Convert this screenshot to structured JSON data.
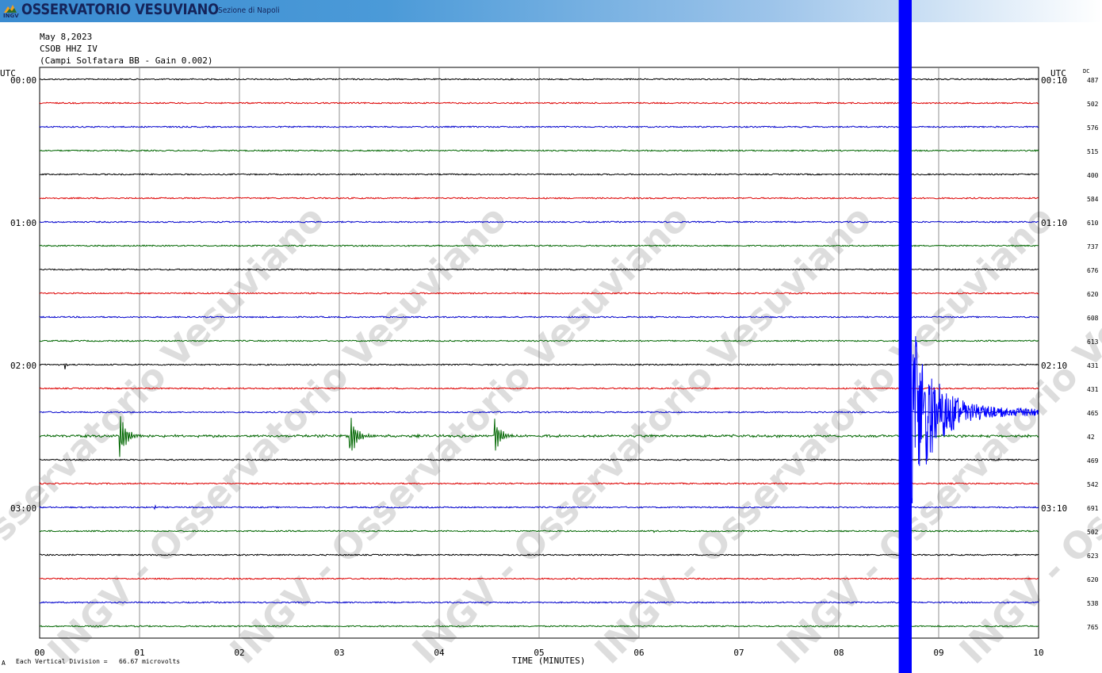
{
  "header": {
    "org_name": "OSSERVATORIO VESUVIANO",
    "org_sub": "Sezione di Napoli",
    "logo_text": "INGV"
  },
  "info": {
    "date": "May 8,2023",
    "station": "CSOB HHZ IV",
    "description": "(Campi Solfatara BB - Gain 0.002)"
  },
  "footer": {
    "division_label": "Each Vertical Division =",
    "division_value": "66.67 microvolts",
    "mark": "A"
  },
  "watermark": "INGV - Osservatorio Vesuviano",
  "colors": {
    "trace_cycle": [
      "#000000",
      "#dd0000",
      "#0000cc",
      "#006600"
    ],
    "header_blue": "#3a8bd0",
    "grid": "#777777"
  },
  "chart_data": {
    "type": "line",
    "title": "",
    "xlabel": "TIME (MINUTES)",
    "left_axis_label": "UTC",
    "right_axis_label": "UTC",
    "dc_label": "DC",
    "xlim": [
      0,
      10
    ],
    "x_ticks": [
      "00",
      "01",
      "02",
      "03",
      "04",
      "05",
      "06",
      "07",
      "08",
      "09",
      "10"
    ],
    "rows_count": 24,
    "row_minutes": 10,
    "left_time_labels": [
      {
        "row": 0,
        "label": "00:00"
      },
      {
        "row": 6,
        "label": "01:00"
      },
      {
        "row": 12,
        "label": "02:00"
      },
      {
        "row": 18,
        "label": "03:00"
      }
    ],
    "right_time_labels": [
      {
        "row": 0,
        "label": "00:10"
      },
      {
        "row": 6,
        "label": "01:10"
      },
      {
        "row": 12,
        "label": "02:10"
      },
      {
        "row": 18,
        "label": "03:10"
      }
    ],
    "dc_values": [
      "487",
      "502",
      "576",
      "515",
      "400",
      "584",
      "610",
      "737",
      "676",
      "620",
      "608",
      "613",
      "431",
      "431",
      "465",
      "42",
      "469",
      "542",
      "691",
      "502",
      "623",
      "620",
      "538",
      "765"
    ],
    "events": [
      {
        "row": 12,
        "minute": 0.25,
        "amplitude": 1.0,
        "duration": 0.12
      },
      {
        "row": 15,
        "minute": 0.8,
        "amplitude": 3.2,
        "duration": 0.55
      },
      {
        "row": 15,
        "minute": 3.1,
        "amplitude": 3.5,
        "duration": 0.55
      },
      {
        "row": 15,
        "minute": 4.55,
        "amplitude": 2.6,
        "duration": 0.5
      },
      {
        "row": 18,
        "minute": 1.15,
        "amplitude": 0.35,
        "duration": 0.2
      },
      {
        "row": 19,
        "minute": 6.15,
        "amplitude": 0.3,
        "duration": 0.1
      },
      {
        "row": 16,
        "minute": 9.6,
        "amplitude": 0.25,
        "duration": 0.1
      },
      {
        "row": 20,
        "minute": 9.75,
        "amplitude": 0.25,
        "duration": 0.08
      },
      {
        "row": 21,
        "minute": 4.3,
        "amplitude": 0.3,
        "duration": 0.05
      }
    ],
    "large_event": {
      "row": 14,
      "minute": 8.6,
      "amplitude": 40,
      "coda_amplitude": 0.7
    }
  }
}
